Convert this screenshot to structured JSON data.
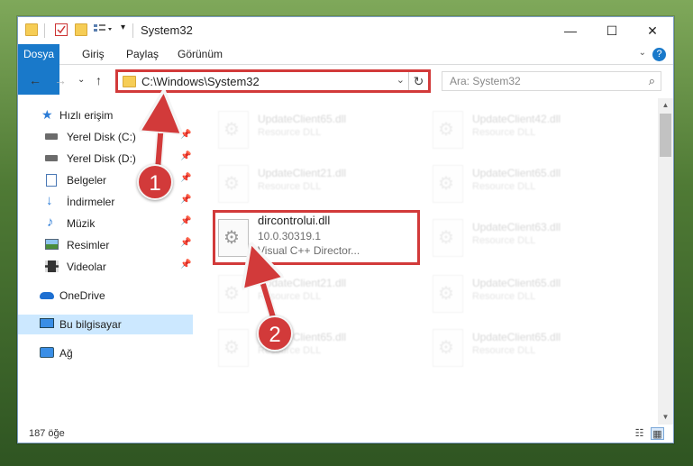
{
  "window": {
    "title": "System32",
    "controls": {
      "minimize": "—",
      "maximize": "☐",
      "close": "✕"
    }
  },
  "ribbon": {
    "tabs": [
      "Dosya",
      "Giriş",
      "Paylaş",
      "Görünüm"
    ],
    "help": "?"
  },
  "address_bar": {
    "path": "C:\\Windows\\System32",
    "search_placeholder": "Ara: System32"
  },
  "nav_pane": {
    "items": [
      {
        "label": "Hızlı erişim",
        "icon": "star-icon"
      },
      {
        "label": "Yerel Disk (C:)",
        "icon": "drive-icon",
        "pinned": true
      },
      {
        "label": "Yerel Disk (D:)",
        "icon": "drive-icon",
        "pinned": true
      },
      {
        "label": "Belgeler",
        "icon": "documents-icon",
        "pinned": true
      },
      {
        "label": "İndirmeler",
        "icon": "download-icon",
        "pinned": true
      },
      {
        "label": "Müzik",
        "icon": "music-icon",
        "pinned": true
      },
      {
        "label": "Resimler",
        "icon": "pictures-icon",
        "pinned": true
      },
      {
        "label": "Videolar",
        "icon": "videos-icon",
        "pinned": true
      },
      {
        "label": "OneDrive",
        "icon": "onedrive-icon"
      },
      {
        "label": "Bu bilgisayar",
        "icon": "computer-icon",
        "selected": true
      },
      {
        "label": "Ağ",
        "icon": "network-icon"
      }
    ]
  },
  "files": [
    {
      "name": "UpdateClient65.dll",
      "desc": "Resource DLL"
    },
    {
      "name": "UpdateClient42.dll",
      "desc": "Resource DLL"
    },
    {
      "name": "UpdateClient21.dll",
      "desc": "Resource DLL"
    },
    {
      "name": "UpdateClient65.dll",
      "desc": "Resource DLL"
    },
    {
      "name": "dircontrolui.dll",
      "version": "10.0.30319.1",
      "desc": "Visual C++ Director..."
    },
    {
      "name": "UpdateClient63.dll",
      "desc": "Resource DLL"
    },
    {
      "name": "UpdateClient21.dll",
      "desc": "Resource DLL"
    },
    {
      "name": "UpdateClient65.dll",
      "desc": "Resource DLL"
    },
    {
      "name": "UpdateClient65.dll",
      "desc": "Resource DLL"
    },
    {
      "name": "UpdateClient65.dll",
      "desc": "Resource DLL"
    }
  ],
  "status": {
    "item_count": "187 öğe"
  },
  "callouts": [
    "1",
    "2"
  ],
  "colors": {
    "accent": "#1979ca",
    "highlight": "#d23a3a",
    "selected": "#cce8ff"
  }
}
